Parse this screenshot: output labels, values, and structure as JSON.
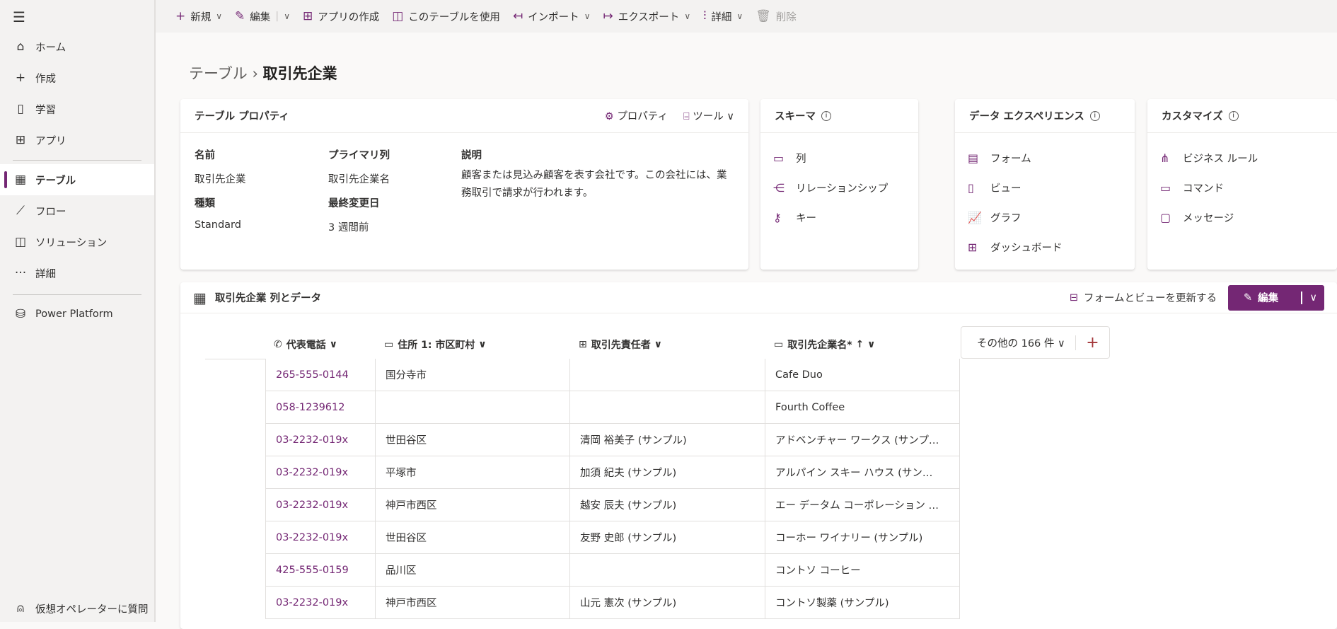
{
  "sidebar": {
    "items": [
      {
        "label": "ホーム",
        "icon": "home-icon"
      },
      {
        "label": "作成",
        "icon": "plus-icon"
      },
      {
        "label": "学習",
        "icon": "book-icon"
      },
      {
        "label": "アプリ",
        "icon": "apps-icon"
      },
      {
        "label": "テーブル",
        "icon": "table-icon"
      },
      {
        "label": "フロー",
        "icon": "flow-icon"
      },
      {
        "label": "ソリューション",
        "icon": "solution-icon"
      },
      {
        "label": "詳細",
        "icon": "more-icon"
      },
      {
        "label": "Power Platform",
        "icon": "power-platform-icon"
      }
    ],
    "bot": "仮想オペレーターに質問"
  },
  "toolbar": {
    "new": "新規",
    "edit": "編集",
    "create_app": "アプリの作成",
    "use_table": "このテーブルを使用",
    "import": "インポート",
    "export": "エクスポート",
    "details": "詳細",
    "delete": "削除"
  },
  "breadcrumb": {
    "parent": "テーブル",
    "current": "取引先企業"
  },
  "properties": {
    "title": "テーブル プロパティ",
    "props_btn": "プロパティ",
    "tools_btn": "ツール",
    "name_label": "名前",
    "name": "取引先企業",
    "type_label": "種類",
    "type": "Standard",
    "primary_label": "プライマリ列",
    "primary": "取引先企業名",
    "modified_label": "最終変更日",
    "modified": "3 週間前",
    "desc_label": "説明",
    "desc": "顧客または見込み顧客を表す会社です。この会社には、業務取引で請求が行われます。"
  },
  "schema": {
    "title": "スキーマ",
    "items": [
      "列",
      "リレーションシップ",
      "キー"
    ]
  },
  "data_experience": {
    "title": "データ エクスペリエンス",
    "items": [
      "フォーム",
      "ビュー",
      "グラフ",
      "ダッシュボード"
    ]
  },
  "customize": {
    "title": "カスタマイズ",
    "items": [
      "ビジネス ルール",
      "コマンド",
      "メッセージ"
    ]
  },
  "data": {
    "title": "取引先企業 列とデータ",
    "refresh": "フォームとビューを更新する",
    "edit": "編集",
    "columns": [
      "代表電話",
      "住所 1: 市区町村",
      "取引先責任者",
      "取引先企業名*"
    ],
    "more": "その他の 166 件",
    "rows": [
      [
        "265-555-0144",
        "国分寺市",
        "",
        "Cafe Duo"
      ],
      [
        "058-1239612",
        "",
        "",
        "Fourth Coffee"
      ],
      [
        "03-2232-019x",
        "世田谷区",
        "清岡 裕美子 (サンプル)",
        "アドベンチャー ワークス (サンプ…"
      ],
      [
        "03-2232-019x",
        "平塚市",
        "加須 紀夫 (サンプル)",
        "アルパイン スキー ハウス (サン…"
      ],
      [
        "03-2232-019x",
        "神戸市西区",
        "越安 辰夫 (サンプル)",
        "エー データム コーポレーション …"
      ],
      [
        "03-2232-019x",
        "世田谷区",
        "友野 史郎 (サンプル)",
        "コーホー ワイナリー (サンプル)"
      ],
      [
        "425-555-0159",
        "品川区",
        "",
        "コントソ コーヒー"
      ],
      [
        "03-2232-019x",
        "神戸市西区",
        "山元 憲次 (サンプル)",
        "コントソ製薬 (サンプル)"
      ]
    ]
  },
  "colors": {
    "accent": "#742774"
  }
}
